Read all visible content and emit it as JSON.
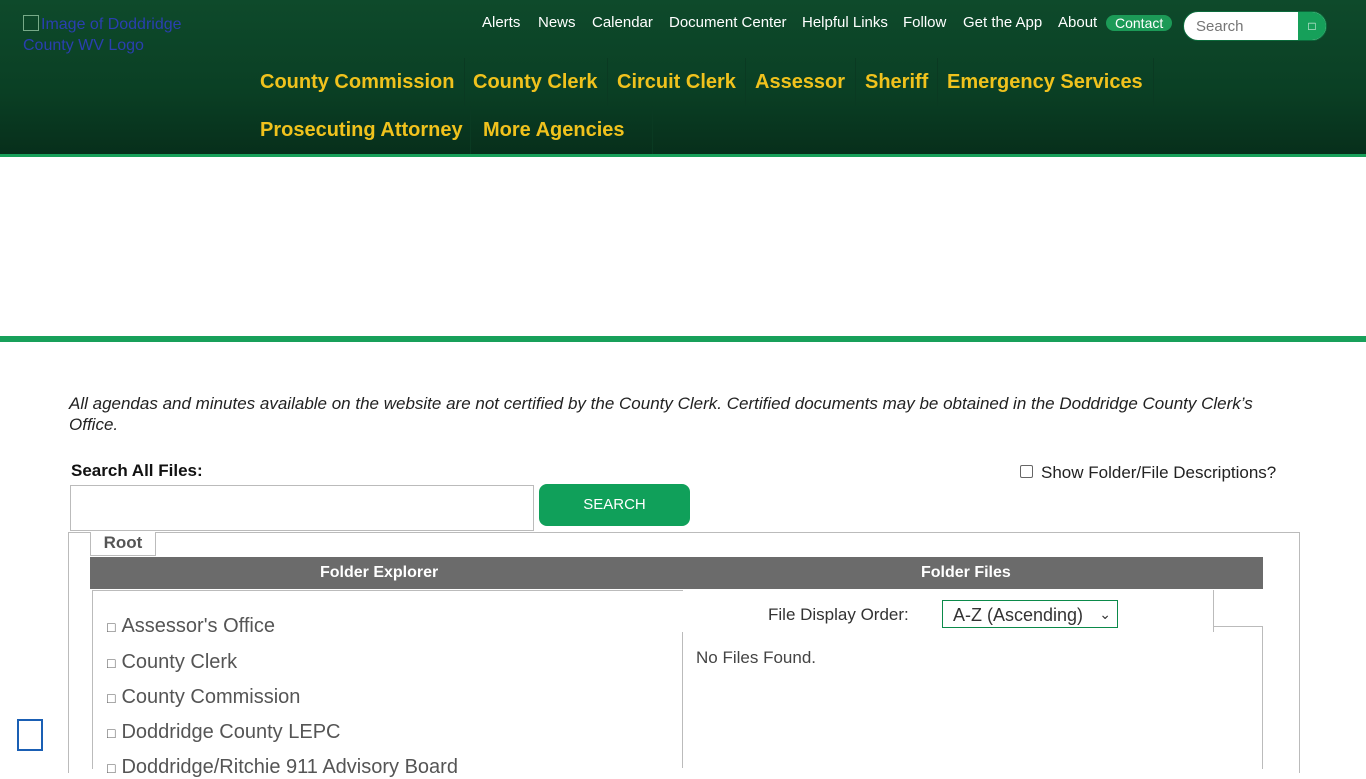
{
  "logo": {
    "alt": "Image of Doddridge County WV Logo"
  },
  "util_nav": {
    "items": [
      "Alerts",
      "News",
      "Calendar",
      "Document Center",
      "Helpful Links",
      "Follow",
      "Get the App",
      "About"
    ],
    "contact": "Contact",
    "search_placeholder": "Search",
    "search_icon": "search-icon"
  },
  "main_nav": {
    "row1": [
      "County Commission",
      "County Clerk",
      "Circuit Clerk",
      "Assessor",
      "Sheriff",
      "Emergency Services"
    ],
    "row2": [
      "Prosecuting Attorney",
      " More Agencies"
    ]
  },
  "disclaimer": "All agendas and minutes available on the website are not certified by the County Clerk. Certified documents may be obtained in the Doddridge County Clerk’s Office.",
  "search": {
    "label": "Search All Files:",
    "button": "SEARCH"
  },
  "show_descriptions": "Show Folder/File Descriptions?",
  "root_tab": "Root",
  "table": {
    "col1": "Folder Explorer",
    "col2": "Folder Files"
  },
  "folders": [
    "Assessor's Office",
    "County Clerk",
    "County Commission",
    "Doddridge County LEPC",
    "Doddridge/Ritchie 911 Advisory Board"
  ],
  "file_display": {
    "label": "File Display Order:",
    "selected": "A-Z (Ascending)"
  },
  "no_files": "No Files Found.",
  "colors": {
    "header_green": "#0e4a2b",
    "accent_green": "#18a05a",
    "nav_gold": "#f0c21d"
  }
}
